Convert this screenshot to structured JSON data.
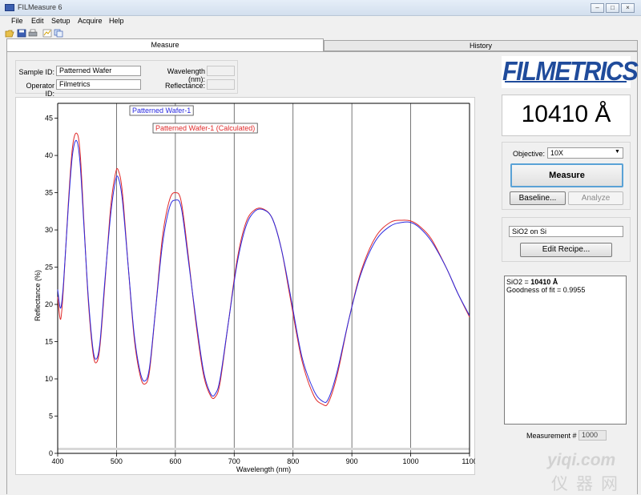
{
  "window": {
    "title": "FILMeasure 6"
  },
  "menu": [
    "File",
    "Edit",
    "Setup",
    "Acquire",
    "Help"
  ],
  "tabs": {
    "measure": "Measure",
    "history": "History"
  },
  "info": {
    "sample_id_label": "Sample ID:",
    "sample_id_value": "Patterned Wafer",
    "operator_id_label": "Operator ID:",
    "operator_id_value": "Filmetrics",
    "wavelength_label": "Wavelength (nm):",
    "wavelength_value": "",
    "reflectance_label": "Reflectance:",
    "reflectance_value": ""
  },
  "logo": "FILMETRICS",
  "thickness": "10410 Å",
  "controls": {
    "objective_label": "Objective:",
    "objective_value": "10X",
    "measure_label": "Measure",
    "baseline_label": "Baseline...",
    "analyze_label": "Analyze"
  },
  "recipe": {
    "name": "SiO2 on Si",
    "edit_label": "Edit Recipe..."
  },
  "results": {
    "line1_prefix": "SiO2 = ",
    "line1_value": "10410 Å",
    "line2": "Goodness of fit = 0.9955"
  },
  "measurement": {
    "label": "Measurement #",
    "value": "1000"
  },
  "watermark": {
    "domain": "yiqi.com",
    "chinese": "仪器网"
  },
  "colors": {
    "measured": "#2a2ae0",
    "calculated": "#e02a2a",
    "logo": "#1f4b9b",
    "focus": "#5aa2d6"
  },
  "chart_data": {
    "type": "line",
    "xlabel": "Wavelength (nm)",
    "ylabel": "Reflectance (%)",
    "xlim": [
      400,
      1100
    ],
    "ylim": [
      0,
      47
    ],
    "xticks": [
      400,
      500,
      600,
      700,
      800,
      900,
      1000,
      1100
    ],
    "yticks": [
      0,
      5,
      10,
      15,
      20,
      25,
      30,
      35,
      40,
      45
    ],
    "grid": "vertical",
    "legend_placement": "top-left",
    "series": [
      {
        "name": "Patterned Wafer-1",
        "color": "#2a2ae0",
        "points": [
          [
            400,
            22
          ],
          [
            405,
            19.5
          ],
          [
            410,
            23
          ],
          [
            418,
            33
          ],
          [
            425,
            40
          ],
          [
            432,
            42
          ],
          [
            438,
            39
          ],
          [
            445,
            30
          ],
          [
            452,
            21
          ],
          [
            460,
            14
          ],
          [
            466,
            12.7
          ],
          [
            472,
            15
          ],
          [
            480,
            23
          ],
          [
            490,
            32
          ],
          [
            498,
            36.5
          ],
          [
            503,
            37
          ],
          [
            510,
            34
          ],
          [
            520,
            25
          ],
          [
            530,
            16
          ],
          [
            540,
            11
          ],
          [
            548,
            9.7
          ],
          [
            556,
            11.5
          ],
          [
            566,
            19
          ],
          [
            578,
            28
          ],
          [
            590,
            33
          ],
          [
            600,
            34
          ],
          [
            610,
            33
          ],
          [
            622,
            26
          ],
          [
            635,
            18
          ],
          [
            648,
            11
          ],
          [
            660,
            8
          ],
          [
            668,
            8
          ],
          [
            676,
            10
          ],
          [
            690,
            17.5
          ],
          [
            705,
            25.5
          ],
          [
            720,
            30.5
          ],
          [
            735,
            32.5
          ],
          [
            750,
            32.7
          ],
          [
            765,
            31.5
          ],
          [
            780,
            27.5
          ],
          [
            795,
            21.5
          ],
          [
            815,
            13
          ],
          [
            835,
            8.5
          ],
          [
            850,
            7
          ],
          [
            860,
            7.3
          ],
          [
            875,
            11
          ],
          [
            895,
            18
          ],
          [
            915,
            24
          ],
          [
            940,
            28.5
          ],
          [
            965,
            30.5
          ],
          [
            985,
            31
          ],
          [
            1000,
            31
          ],
          [
            1015,
            30.3
          ],
          [
            1035,
            28.5
          ],
          [
            1060,
            25
          ],
          [
            1080,
            21.5
          ],
          [
            1100,
            18.5
          ]
        ]
      },
      {
        "name": "Patterned Wafer-1 (Calculated)",
        "color": "#e02a2a",
        "points": [
          [
            400,
            21
          ],
          [
            405,
            18
          ],
          [
            410,
            22.5
          ],
          [
            418,
            33.5
          ],
          [
            425,
            41
          ],
          [
            432,
            43
          ],
          [
            438,
            40.5
          ],
          [
            445,
            30.5
          ],
          [
            452,
            20.5
          ],
          [
            460,
            13.5
          ],
          [
            466,
            12.2
          ],
          [
            472,
            14.5
          ],
          [
            480,
            22.5
          ],
          [
            490,
            33
          ],
          [
            498,
            37.5
          ],
          [
            503,
            38
          ],
          [
            510,
            35
          ],
          [
            520,
            25
          ],
          [
            530,
            15.5
          ],
          [
            540,
            10.5
          ],
          [
            548,
            9.3
          ],
          [
            556,
            11
          ],
          [
            566,
            19
          ],
          [
            578,
            29
          ],
          [
            590,
            34
          ],
          [
            600,
            35
          ],
          [
            610,
            33.8
          ],
          [
            622,
            26.5
          ],
          [
            635,
            17.5
          ],
          [
            648,
            10.5
          ],
          [
            660,
            7.7
          ],
          [
            668,
            7.6
          ],
          [
            676,
            9.5
          ],
          [
            690,
            17.5
          ],
          [
            705,
            26
          ],
          [
            720,
            31
          ],
          [
            735,
            32.7
          ],
          [
            750,
            32.8
          ],
          [
            765,
            31.5
          ],
          [
            780,
            27.5
          ],
          [
            795,
            21
          ],
          [
            815,
            12.5
          ],
          [
            835,
            7.8
          ],
          [
            850,
            6.6
          ],
          [
            860,
            6.8
          ],
          [
            875,
            10.5
          ],
          [
            895,
            18
          ],
          [
            915,
            24.3
          ],
          [
            940,
            29
          ],
          [
            965,
            31
          ],
          [
            985,
            31.3
          ],
          [
            1000,
            31.2
          ],
          [
            1015,
            30.5
          ],
          [
            1035,
            28.8
          ],
          [
            1060,
            25
          ],
          [
            1080,
            21.5
          ],
          [
            1100,
            18.3
          ]
        ]
      }
    ]
  }
}
